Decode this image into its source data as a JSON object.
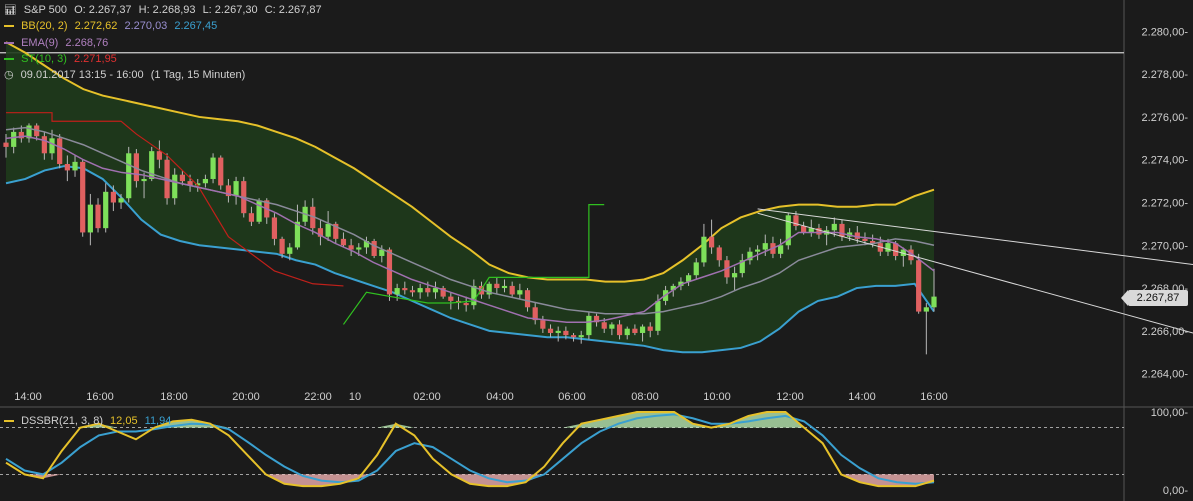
{
  "header": {
    "symbol": "S&P 500",
    "open": "O: 2.267,37",
    "high": "H: 2.268,93",
    "low": "L: 2.267,30",
    "close": "C: 2.267,87",
    "bb_label": "BB(20, 2)",
    "bb_v1": "2.272,62",
    "bb_v2": "2.270,03",
    "bb_v3": "2.267,45",
    "ema_label": "EMA(9)",
    "ema_value": "2.268,76",
    "st_label": "ST(10, 3)",
    "st_value": "2.271,95",
    "period": "09.01.2017 13:15 - 16:00",
    "interval": "(1 Tag, 15 Minuten)"
  },
  "last_price": "2.267,87",
  "oscillator": {
    "label": "DSSBR(21, 3, 8)",
    "v1": "12,05",
    "v2": "11,94"
  },
  "colors": {
    "background": "#1b1b1b",
    "bb_upper_lower_mid": "#e6c12a",
    "bb_lower": "#3aa0d0",
    "band_fill": "#1f3b1c",
    "ema": "#a070b0",
    "mid_gray": "#8a8a9a",
    "supertrend_red": "#c0201a",
    "supertrend_green": "#30c020",
    "candle_up": "#7ee05a",
    "candle_down": "#e06060"
  },
  "chart_data": {
    "type": "candlestick",
    "y_ticks": [
      "2.280,00-",
      "2.278,00-",
      "2.276,00-",
      "2.274,00-",
      "2.272,00-",
      "2.270,00-",
      "2.268,00-",
      "2.266,00-",
      "2.264,00-"
    ],
    "y_values": [
      2280,
      2278,
      2276,
      2274,
      2272,
      2270,
      2268,
      2266,
      2264
    ],
    "ylim": [
      2263,
      2281
    ],
    "x_ticks": [
      "14:00",
      "16:00",
      "18:00",
      "20:00",
      "22:00",
      "10",
      "02:00",
      "04:00",
      "06:00",
      "08:00",
      "10:00",
      "12:00",
      "14:00",
      "16:00"
    ],
    "osc_ticks": [
      "100,00-",
      "0,00-"
    ],
    "osc_ylim": [
      0,
      100
    ],
    "osc_levels": [
      80,
      20
    ],
    "horizontal_line": 2279,
    "candles": [
      [
        2274.8,
        2275.2,
        2274.1,
        2274.6
      ],
      [
        2274.6,
        2275.5,
        2274.3,
        2275.3
      ],
      [
        2275.3,
        2275.6,
        2274.8,
        2275.0
      ],
      [
        2275.0,
        2275.7,
        2274.8,
        2275.6
      ],
      [
        2275.6,
        2275.7,
        2274.9,
        2275.1
      ],
      [
        2275.1,
        2275.3,
        2274.0,
        2274.3
      ],
      [
        2274.3,
        2275.4,
        2274.0,
        2275.0
      ],
      [
        2275.0,
        2275.2,
        2273.6,
        2273.8
      ],
      [
        2273.8,
        2274.2,
        2273.0,
        2273.5
      ],
      [
        2273.5,
        2274.2,
        2273.2,
        2273.9
      ],
      [
        2273.9,
        2274.0,
        2270.4,
        2270.6
      ],
      [
        2270.6,
        2272.4,
        2270.0,
        2271.9
      ],
      [
        2271.9,
        2272.2,
        2270.6,
        2270.8
      ],
      [
        2270.8,
        2272.9,
        2270.6,
        2272.5
      ],
      [
        2272.5,
        2272.8,
        2271.6,
        2272.0
      ],
      [
        2272.0,
        2272.4,
        2271.7,
        2272.2
      ],
      [
        2272.2,
        2274.6,
        2272.0,
        2274.3
      ],
      [
        2274.3,
        2274.5,
        2272.7,
        2273.0
      ],
      [
        2273.0,
        2273.4,
        2272.2,
        2273.1
      ],
      [
        2273.1,
        2274.6,
        2273.0,
        2274.4
      ],
      [
        2274.4,
        2274.9,
        2273.6,
        2274.0
      ],
      [
        2274.0,
        2274.3,
        2271.9,
        2272.2
      ],
      [
        2272.2,
        2273.6,
        2271.9,
        2273.3
      ],
      [
        2273.3,
        2273.5,
        2272.8,
        2273.0
      ],
      [
        2273.0,
        2273.3,
        2272.5,
        2272.8
      ],
      [
        2272.8,
        2273.1,
        2272.5,
        2272.9
      ],
      [
        2272.9,
        2273.3,
        2272.7,
        2273.1
      ],
      [
        2273.1,
        2274.3,
        2272.9,
        2274.1
      ],
      [
        2274.1,
        2274.2,
        2272.6,
        2272.8
      ],
      [
        2272.8,
        2273.1,
        2272.0,
        2272.3
      ],
      [
        2272.3,
        2273.2,
        2271.9,
        2273.0
      ],
      [
        2273.0,
        2273.2,
        2271.3,
        2271.5
      ],
      [
        2271.5,
        2271.8,
        2270.9,
        2271.1
      ],
      [
        2271.1,
        2272.2,
        2271.0,
        2272.1
      ],
      [
        2272.1,
        2272.2,
        2271.0,
        2271.3
      ],
      [
        2271.3,
        2271.5,
        2270.0,
        2270.3
      ],
      [
        2270.3,
        2270.4,
        2269.4,
        2269.6
      ],
      [
        2269.6,
        2270.1,
        2269.3,
        2269.9
      ],
      [
        2269.9,
        2271.9,
        2269.8,
        2271.1
      ],
      [
        2271.1,
        2272.1,
        2270.9,
        2271.8
      ],
      [
        2271.8,
        2272.2,
        2270.5,
        2270.8
      ],
      [
        2270.8,
        2271.2,
        2270.0,
        2270.4
      ],
      [
        2270.4,
        2271.6,
        2270.2,
        2271.0
      ],
      [
        2271.0,
        2271.1,
        2270.1,
        2270.3
      ],
      [
        2270.3,
        2270.6,
        2269.9,
        2270.0
      ],
      [
        2270.0,
        2270.3,
        2269.5,
        2269.8
      ],
      [
        2269.8,
        2270.1,
        2269.5,
        2269.9
      ],
      [
        2269.9,
        2270.4,
        2269.6,
        2270.2
      ],
      [
        2270.2,
        2270.3,
        2269.4,
        2269.5
      ],
      [
        2269.5,
        2270.0,
        2269.2,
        2269.8
      ],
      [
        2269.8,
        2269.9,
        2267.4,
        2267.7
      ],
      [
        2267.7,
        2268.2,
        2267.4,
        2268.0
      ],
      [
        2268.0,
        2268.3,
        2267.7,
        2267.9
      ],
      [
        2267.9,
        2268.1,
        2267.6,
        2267.8
      ],
      [
        2267.8,
        2268.2,
        2267.5,
        2268.0
      ],
      [
        2268.0,
        2268.3,
        2267.6,
        2267.8
      ],
      [
        2267.8,
        2268.3,
        2267.5,
        2268.0
      ],
      [
        2268.0,
        2268.1,
        2267.5,
        2267.6
      ],
      [
        2267.6,
        2267.8,
        2267.0,
        2267.4
      ],
      [
        2267.4,
        2267.6,
        2267.0,
        2267.3
      ],
      [
        2267.3,
        2267.6,
        2266.9,
        2267.2
      ],
      [
        2267.2,
        2268.4,
        2267.0,
        2268.1
      ],
      [
        2268.1,
        2268.3,
        2267.5,
        2267.7
      ],
      [
        2267.7,
        2268.3,
        2267.5,
        2268.2
      ],
      [
        2268.2,
        2268.5,
        2267.7,
        2268.0
      ],
      [
        2268.0,
        2268.4,
        2267.8,
        2268.1
      ],
      [
        2268.1,
        2268.3,
        2267.6,
        2267.7
      ],
      [
        2267.7,
        2268.2,
        2267.5,
        2267.9
      ],
      [
        2267.9,
        2268.0,
        2266.9,
        2267.1
      ],
      [
        2267.1,
        2267.3,
        2266.3,
        2266.5
      ],
      [
        2266.5,
        2266.7,
        2265.9,
        2266.1
      ],
      [
        2266.1,
        2266.3,
        2265.7,
        2265.9
      ],
      [
        2265.9,
        2266.2,
        2265.5,
        2266.0
      ],
      [
        2266.0,
        2266.2,
        2265.6,
        2265.8
      ],
      [
        2265.8,
        2265.9,
        2265.5,
        2265.7
      ],
      [
        2265.7,
        2266.0,
        2265.4,
        2265.8
      ],
      [
        2265.8,
        2266.9,
        2265.6,
        2266.7
      ],
      [
        2266.7,
        2266.8,
        2266.2,
        2266.4
      ],
      [
        2266.4,
        2266.6,
        2265.9,
        2266.1
      ],
      [
        2266.1,
        2266.4,
        2265.8,
        2266.3
      ],
      [
        2266.3,
        2266.5,
        2265.6,
        2265.8
      ],
      [
        2265.8,
        2266.2,
        2265.6,
        2266.1
      ],
      [
        2266.1,
        2266.3,
        2265.8,
        2265.9
      ],
      [
        2265.9,
        2266.3,
        2265.5,
        2266.2
      ],
      [
        2266.2,
        2266.4,
        2265.7,
        2266.0
      ],
      [
        2266.0,
        2267.7,
        2265.8,
        2267.4
      ],
      [
        2267.4,
        2268.1,
        2267.2,
        2267.9
      ],
      [
        2267.9,
        2268.2,
        2267.6,
        2268.1
      ],
      [
        2268.1,
        2268.5,
        2267.9,
        2268.3
      ],
      [
        2268.3,
        2268.7,
        2268.1,
        2268.6
      ],
      [
        2268.6,
        2269.4,
        2268.4,
        2269.2
      ],
      [
        2269.2,
        2271.0,
        2269.0,
        2270.4
      ],
      [
        2270.4,
        2271.2,
        2269.6,
        2269.9
      ],
      [
        2269.9,
        2270.0,
        2269.0,
        2269.3
      ],
      [
        2269.3,
        2269.5,
        2268.2,
        2268.5
      ],
      [
        2268.5,
        2269.0,
        2267.9,
        2268.7
      ],
      [
        2268.7,
        2269.6,
        2268.5,
        2269.3
      ],
      [
        2269.3,
        2269.9,
        2269.1,
        2269.7
      ],
      [
        2269.7,
        2270.0,
        2269.3,
        2269.8
      ],
      [
        2269.8,
        2270.5,
        2269.5,
        2270.1
      ],
      [
        2270.1,
        2270.4,
        2269.4,
        2269.6
      ],
      [
        2269.6,
        2270.3,
        2269.4,
        2270.0
      ],
      [
        2270.0,
        2271.5,
        2269.8,
        2271.4
      ],
      [
        2271.4,
        2271.6,
        2270.7,
        2270.9
      ],
      [
        2270.9,
        2271.1,
        2270.5,
        2270.6
      ],
      [
        2270.6,
        2271.2,
        2270.4,
        2270.8
      ],
      [
        2270.8,
        2271.0,
        2270.3,
        2270.5
      ],
      [
        2270.5,
        2270.9,
        2270.0,
        2270.7
      ],
      [
        2270.7,
        2271.3,
        2270.4,
        2271.0
      ],
      [
        2271.0,
        2271.2,
        2270.2,
        2270.4
      ],
      [
        2270.4,
        2270.8,
        2270.2,
        2270.6
      ],
      [
        2270.6,
        2270.9,
        2270.1,
        2270.3
      ],
      [
        2270.3,
        2270.6,
        2270.0,
        2270.2
      ],
      [
        2270.2,
        2270.5,
        2269.9,
        2270.1
      ],
      [
        2270.1,
        2270.4,
        2269.5,
        2269.7
      ],
      [
        2269.7,
        2270.3,
        2269.5,
        2270.1
      ],
      [
        2270.1,
        2270.2,
        2269.3,
        2269.5
      ],
      [
        2269.5,
        2269.9,
        2269.0,
        2269.8
      ],
      [
        2269.8,
        2270.0,
        2269.1,
        2269.3
      ],
      [
        2269.3,
        2269.6,
        2266.8,
        2266.9
      ],
      [
        2266.9,
        2267.3,
        2264.9,
        2267.1
      ],
      [
        2267.1,
        2268.9,
        2266.9,
        2267.6
      ]
    ],
    "bb_upper": [
      2279.5,
      2279.0,
      2278.4,
      2277.8,
      2277.3,
      2277.0,
      2276.8,
      2276.6,
      2276.4,
      2276.2,
      2276.0,
      2275.9,
      2275.8,
      2275.6,
      2275.3,
      2275.0,
      2274.6,
      2274.1,
      2273.6,
      2273.0,
      2272.4,
      2271.8,
      2271.1,
      2270.4,
      2269.8,
      2269.1,
      2268.7,
      2268.5,
      2268.4,
      2268.4,
      2268.4,
      2268.3,
      2268.3,
      2268.4,
      2268.7,
      2269.3,
      2270.0,
      2270.8,
      2271.3,
      2271.6,
      2271.8,
      2271.9,
      2271.9,
      2271.8,
      2271.8,
      2271.9,
      2271.9,
      2272.3,
      2272.6
    ],
    "bb_lower": [
      2272.9,
      2273.1,
      2273.5,
      2273.7,
      2273.6,
      2273.1,
      2272.2,
      2271.2,
      2270.5,
      2270.2,
      2270.0,
      2269.9,
      2269.8,
      2269.7,
      2269.6,
      2269.3,
      2269.1,
      2268.7,
      2268.4,
      2268.1,
      2267.8,
      2267.4,
      2267.0,
      2266.6,
      2266.3,
      2266.0,
      2265.9,
      2265.8,
      2265.7,
      2265.7,
      2265.6,
      2265.5,
      2265.4,
      2265.3,
      2265.1,
      2265.0,
      2265.0,
      2265.1,
      2265.2,
      2265.5,
      2266.1,
      2266.9,
      2267.4,
      2267.6,
      2268.0,
      2268.1,
      2268.1,
      2268.2,
      2266.9
    ],
    "bb_mid": [
      2275.4,
      2275.5,
      2275.3,
      2275.0,
      2274.7,
      2274.3,
      2273.9,
      2273.5,
      2273.2,
      2272.9,
      2272.7,
      2272.5,
      2272.3,
      2272.1,
      2271.9,
      2271.6,
      2271.3,
      2270.9,
      2270.5,
      2270.0,
      2269.6,
      2269.2,
      2268.8,
      2268.4,
      2268.1,
      2267.8,
      2267.6,
      2267.4,
      2267.2,
      2267.0,
      2266.9,
      2266.8,
      2266.8,
      2266.8,
      2266.9,
      2267.1,
      2267.3,
      2267.6,
      2268.0,
      2268.3,
      2268.7,
      2269.3,
      2269.6,
      2269.9,
      2270.0,
      2270.1,
      2270.3,
      2270.2,
      2270.0
    ],
    "ema": [
      2275.0,
      2275.1,
      2274.9,
      2274.5,
      2274.0,
      2273.6,
      2273.4,
      2273.3,
      2273.1,
      2272.9,
      2272.7,
      2272.5,
      2272.3,
      2271.9,
      2271.5,
      2271.0,
      2270.6,
      2270.1,
      2269.7,
      2269.2,
      2268.8,
      2268.4,
      2268.1,
      2267.8,
      2267.5,
      2267.2,
      2266.9,
      2266.6,
      2266.5,
      2266.4,
      2266.4,
      2266.5,
      2266.7,
      2266.9,
      2267.6,
      2268.2,
      2268.5,
      2268.8,
      2269.2,
      2269.6,
      2270.0,
      2270.6,
      2270.6,
      2270.6,
      2270.4,
      2270.3,
      2270.1,
      2269.5,
      2268.8
    ],
    "supertrend_red": [
      [
        0,
        2276.2
      ],
      [
        6,
        2276.2
      ],
      [
        6,
        2275.8
      ],
      [
        15,
        2275.8
      ],
      [
        17,
        2275.2
      ],
      [
        21,
        2274.2
      ],
      [
        25,
        2272.8
      ],
      [
        29,
        2270.4
      ],
      [
        35,
        2268.8
      ],
      [
        40,
        2268.2
      ],
      [
        44,
        2268.1
      ]
    ],
    "supertrend_green": [
      [
        44,
        2266.3
      ],
      [
        47,
        2267.8
      ],
      [
        55,
        2267.3
      ],
      [
        58,
        2267.3
      ],
      [
        61,
        2267.4
      ],
      [
        63,
        2268.5
      ],
      [
        76,
        2268.5
      ],
      [
        76,
        2271.9
      ],
      [
        78,
        2271.9
      ]
    ],
    "trend_line_upper": [
      [
        2271.7,
        0
      ],
      [
        2269.1,
        1
      ]
    ],
    "trend_line_lower": [
      [
        2271.5,
        0
      ],
      [
        2265.9,
        1
      ]
    ],
    "osc_series_1": [
      35,
      20,
      15,
      50,
      80,
      85,
      75,
      65,
      80,
      88,
      90,
      85,
      70,
      45,
      20,
      8,
      5,
      5,
      8,
      15,
      45,
      85,
      70,
      40,
      20,
      8,
      5,
      5,
      10,
      30,
      60,
      85,
      90,
      95,
      100,
      100,
      100,
      85,
      80,
      85,
      95,
      100,
      100,
      80,
      60,
      20,
      10,
      5,
      5,
      5,
      12
    ],
    "osc_series_2": [
      40,
      25,
      20,
      35,
      55,
      70,
      75,
      75,
      78,
      82,
      85,
      84,
      78,
      62,
      45,
      30,
      18,
      12,
      10,
      12,
      25,
      50,
      60,
      55,
      40,
      25,
      15,
      10,
      12,
      20,
      40,
      60,
      75,
      85,
      92,
      95,
      97,
      92,
      85,
      85,
      88,
      92,
      95,
      88,
      70,
      45,
      28,
      15,
      10,
      8,
      10
    ]
  }
}
